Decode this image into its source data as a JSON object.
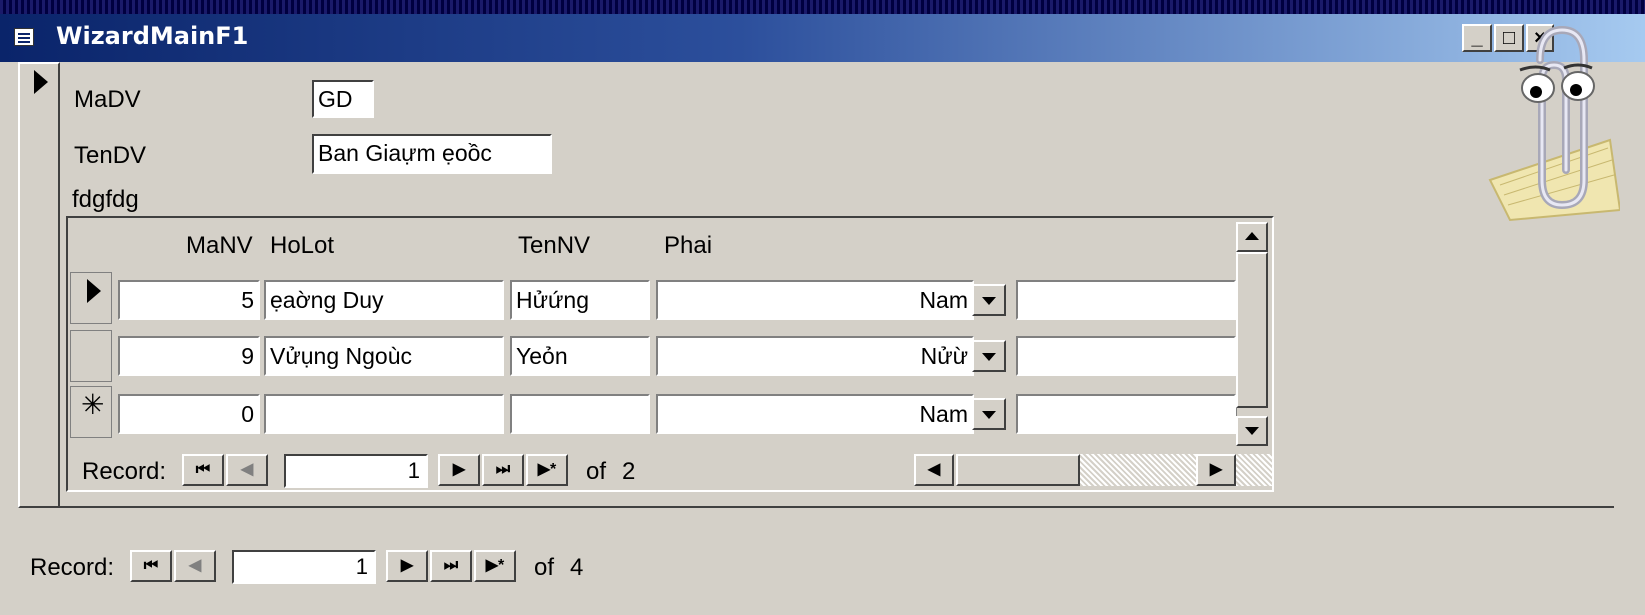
{
  "window": {
    "title": "WizardMainF1",
    "controls": [
      "_",
      "□",
      "×"
    ]
  },
  "form": {
    "fields": [
      {
        "label": "MaDV",
        "value": "GD"
      },
      {
        "label": "TenDV",
        "value": "Ban Giaựm ẹoồc"
      }
    ],
    "subform_label": "fdgfdg"
  },
  "subform": {
    "columns": [
      "MaNV",
      "HoLot",
      "TenNV",
      "Phai"
    ],
    "rows": [
      {
        "marker": "current",
        "manv": "5",
        "holot": "ẹaờng Duy",
        "tennv": "Hửứng",
        "phai": "Nam"
      },
      {
        "marker": "",
        "manv": "9",
        "holot": "Vửụng Ngoùc",
        "tennv": "Yeỏn",
        "phai": "Nửừ"
      },
      {
        "marker": "new",
        "manv": "0",
        "holot": "",
        "tennv": "",
        "phai": "Nam"
      }
    ],
    "nav": {
      "label": "Record:",
      "current": "1",
      "of_text": "of",
      "total": "2"
    }
  },
  "main_nav": {
    "label": "Record:",
    "current": "1",
    "of_text": "of",
    "total": "4"
  },
  "icons": {
    "first": "⏮",
    "prev": "◀",
    "next": "▶",
    "last": "⏭",
    "new": "▶*"
  }
}
